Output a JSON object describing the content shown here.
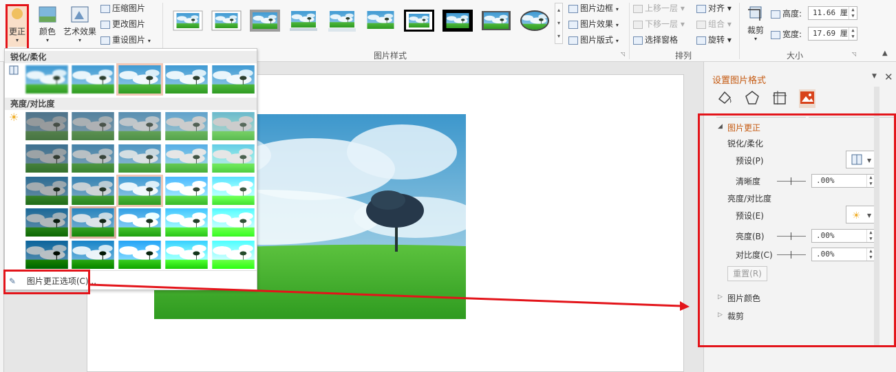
{
  "ribbon": {
    "correct_label": "更正",
    "color_label": "颜色",
    "art_label": "艺术效果",
    "compress_label": "压缩图片",
    "change_label": "更改图片",
    "reset_label": "重设图片",
    "styles_group": "图片样式",
    "border_label": "图片边框",
    "effect_label": "图片效果",
    "layout_label": "图片版式",
    "bring_forward": "上移一层",
    "send_backward": "下移一层",
    "selection_pane": "选择窗格",
    "align": "对齐",
    "group": "组合",
    "rotate": "旋转",
    "arrange_group": "排列",
    "crop_label": "裁剪",
    "height_label": "高度:",
    "height_value": "11.66 厘",
    "width_label": "宽度:",
    "width_value": "17.69 厘",
    "size_group": "大小"
  },
  "dropdown": {
    "sharpen_header": "锐化/柔化",
    "brightness_header": "亮度/对比度",
    "options_label": "图片更正选项(C)..."
  },
  "panel": {
    "title": "设置图片格式",
    "section_correct": "图片更正",
    "sharpen_label": "锐化/柔化",
    "preset1": "预设(P)",
    "clarity": "清晰度",
    "clarity_value": ".00%",
    "brightness_section": "亮度/对比度",
    "preset2": "预设(E)",
    "brightness": "亮度(B)",
    "brightness_value": ".00%",
    "contrast": "对比度(C)",
    "contrast_value": ".00%",
    "reset": "重置(R)",
    "section_color": "图片颜色",
    "section_crop": "裁剪"
  },
  "colors": {
    "accent": "#c55a11",
    "highlight": "#e3141a",
    "selected": "#f2c7b5"
  }
}
